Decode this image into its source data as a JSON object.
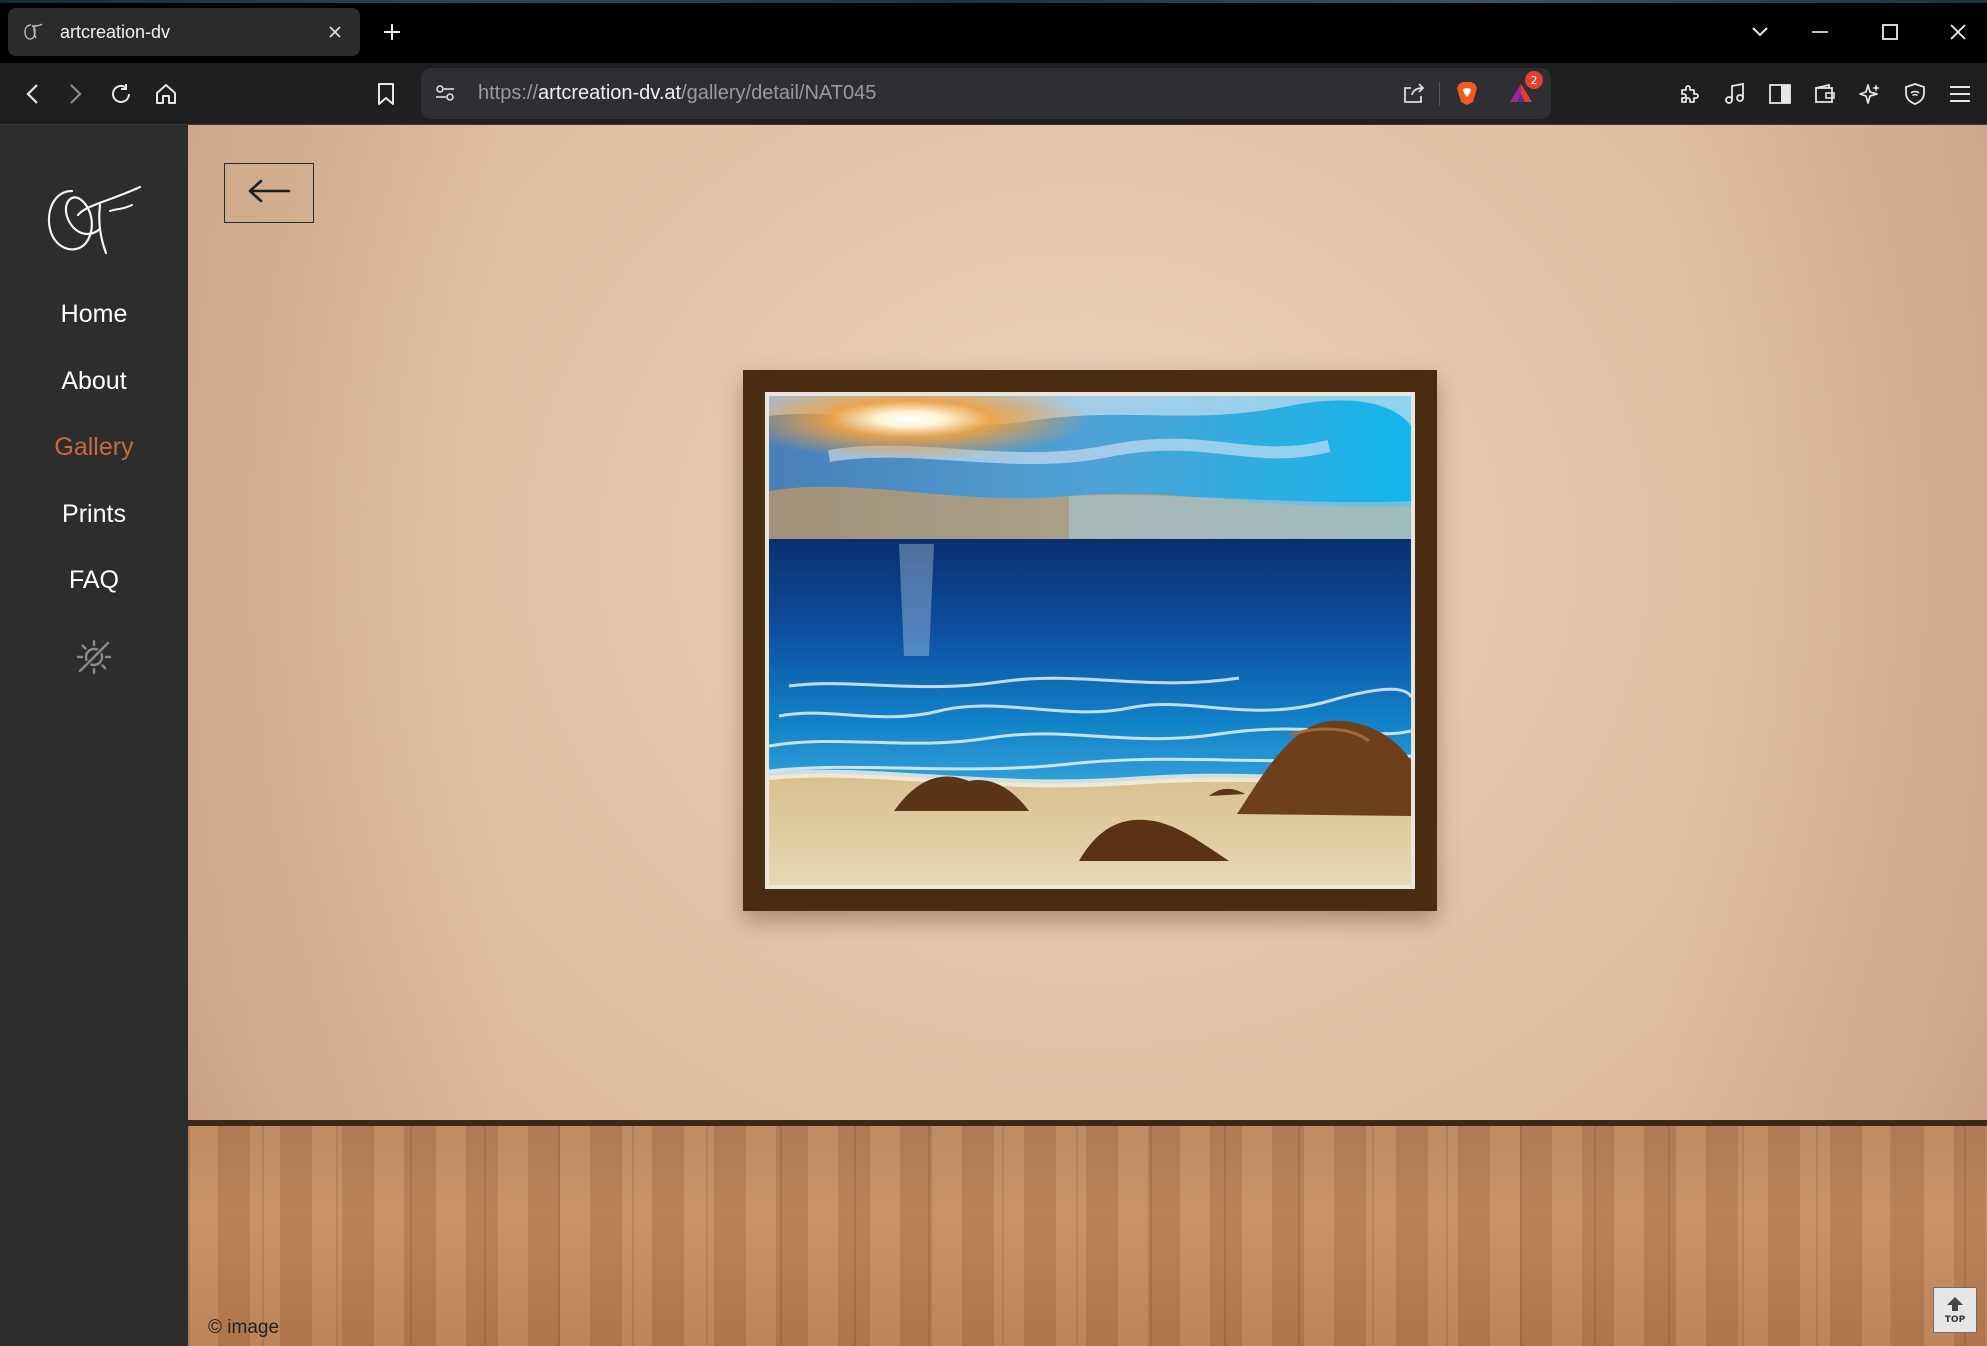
{
  "browser": {
    "tab_title": "artcreation-dv",
    "url_scheme": "https://",
    "url_host": "artcreation-dv.at",
    "url_path": "/gallery/detail/NAT045",
    "rewards_badge_count": "2",
    "brand_color": "#f15a22"
  },
  "sidebar": {
    "nav": [
      {
        "label": "Home"
      },
      {
        "label": "About"
      },
      {
        "label": "Gallery",
        "active": true
      },
      {
        "label": "Prints"
      },
      {
        "label": "FAQ"
      }
    ],
    "active_color": "#c8693d",
    "theme_toggle_icon": "theme-toggle-icon"
  },
  "gallery": {
    "back_icon": "arrow-left-icon",
    "artwork_id": "NAT045",
    "credit": "© image",
    "top_button_label": "TOP"
  }
}
